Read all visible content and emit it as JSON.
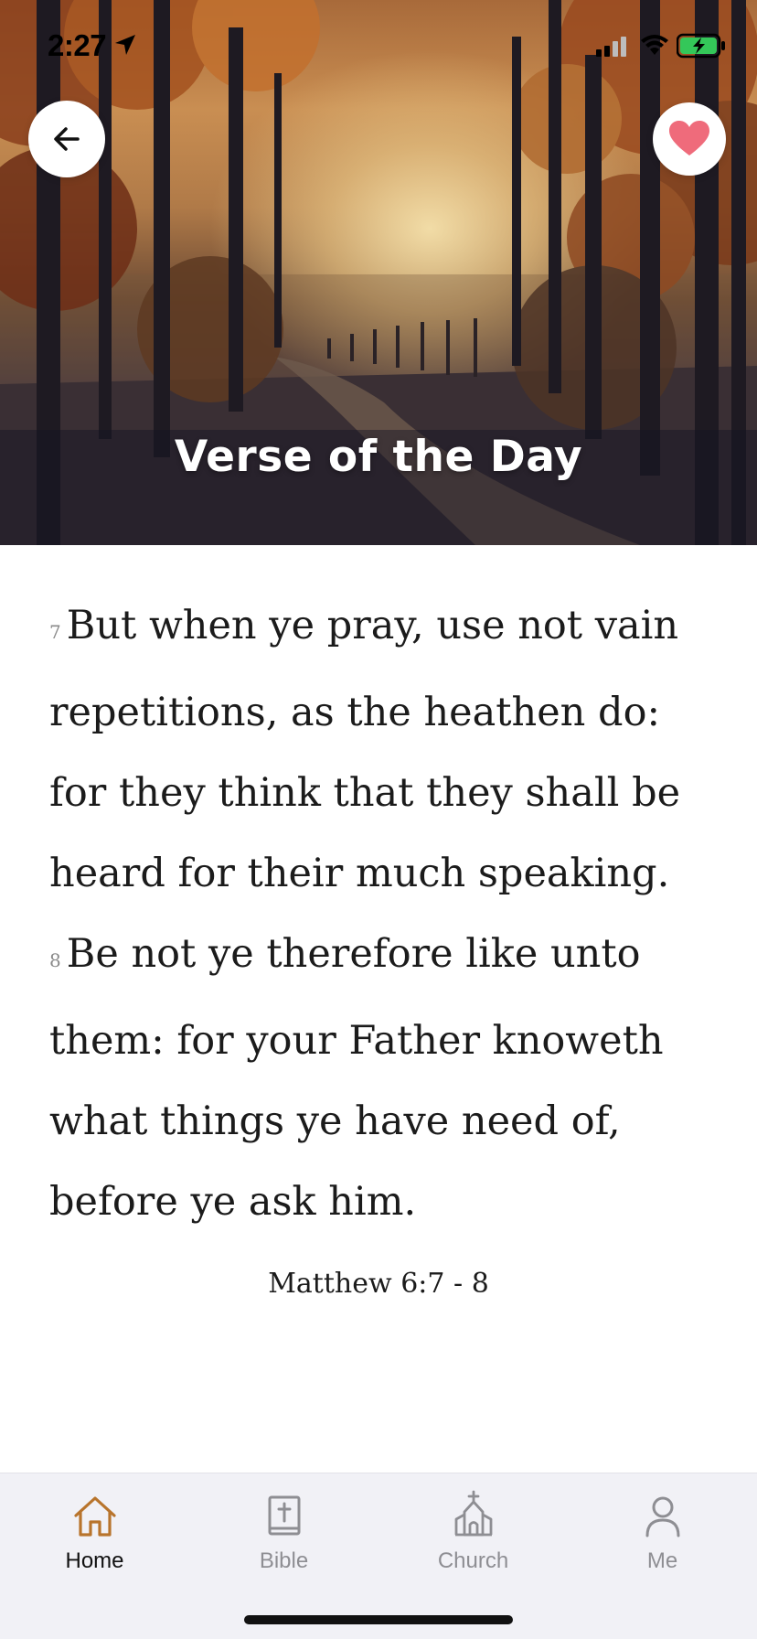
{
  "status_bar": {
    "time": "2:27"
  },
  "hero": {
    "title": "Verse of the Day"
  },
  "verses": [
    {
      "number": "7",
      "text": "But when ye pray, use not vain repetitions, as the heathen do: for they think that they shall be heard for their much speaking."
    },
    {
      "number": "8",
      "text": "Be not ye therefore like unto them: for your Father knoweth what things ye have need of, before ye ask him."
    }
  ],
  "reference": "Matthew 6:7 - 8",
  "tabs": [
    {
      "label": "Home",
      "icon": "home-icon",
      "active": true
    },
    {
      "label": "Bible",
      "icon": "bible-icon",
      "active": false
    },
    {
      "label": "Church",
      "icon": "church-icon",
      "active": false
    },
    {
      "label": "Me",
      "icon": "person-icon",
      "active": false
    }
  ],
  "colors": {
    "accent": "#b8742c",
    "heart": "#ef6b7b",
    "tab_inactive": "#8e8e93",
    "battery": "#34c759"
  }
}
